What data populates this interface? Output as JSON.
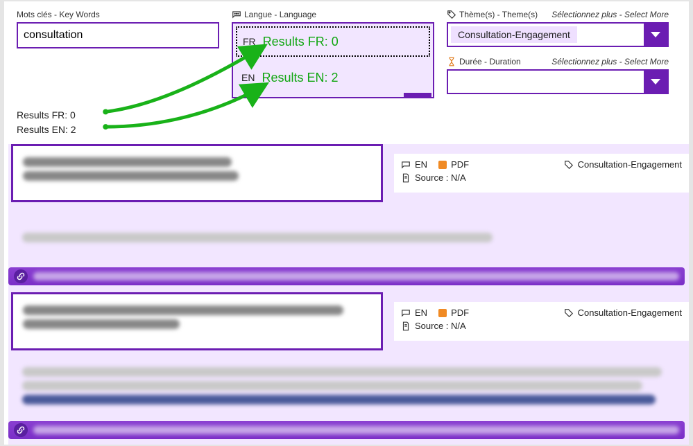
{
  "filters": {
    "keywords": {
      "label": "Mots clés - Key Words",
      "value": "consultation"
    },
    "language": {
      "label": "Langue - Language",
      "fr_tag": "FR",
      "en_tag": "EN",
      "fr_results": "Results FR: 0",
      "en_results": "Results EN: 2"
    },
    "themes": {
      "label": "Thème(s) - Theme(s)",
      "select_more": "Sélectionnez plus - Select More",
      "selected": "Consultation-Engagement"
    },
    "duration": {
      "label": "Durée - Duration",
      "select_more": "Sélectionnez plus - Select More"
    }
  },
  "below": {
    "fr": "Results FR: 0",
    "en": "Results EN: 2"
  },
  "results": [
    {
      "lang": "EN",
      "format": "PDF",
      "theme": "Consultation-Engagement",
      "source": "Source : N/A"
    },
    {
      "lang": "EN",
      "format": "PDF",
      "theme": "Consultation-Engagement",
      "source": "Source : N/A"
    }
  ]
}
